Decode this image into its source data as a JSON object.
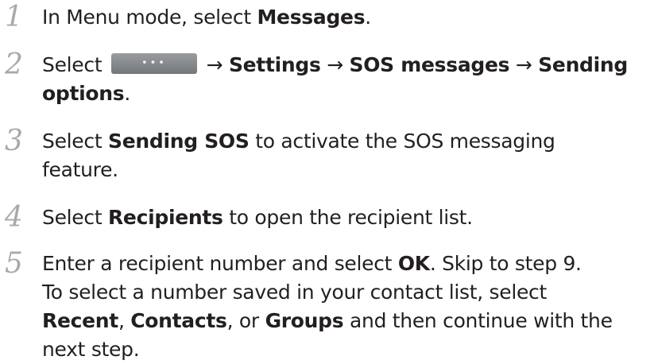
{
  "steps": [
    {
      "number": "1",
      "lines": [
        [
          {
            "t": "In Menu mode, select ",
            "b": false
          },
          {
            "t": "Messages",
            "b": true
          },
          {
            "t": ".",
            "b": false
          }
        ]
      ]
    },
    {
      "number": "2",
      "lines": [
        [
          {
            "t": "Select ",
            "b": false
          },
          {
            "icon": "more-options-button"
          },
          {
            "t": " → ",
            "b": false
          },
          {
            "t": "Settings",
            "b": true
          },
          {
            "t": " → ",
            "b": false
          },
          {
            "t": "SOS messages",
            "b": true
          },
          {
            "t": " → ",
            "b": false
          },
          {
            "t": "Sending",
            "b": true
          }
        ],
        [
          {
            "t": "options",
            "b": true
          },
          {
            "t": ".",
            "b": false
          }
        ]
      ]
    },
    {
      "number": "3",
      "lines": [
        [
          {
            "t": "Select ",
            "b": false
          },
          {
            "t": "Sending SOS",
            "b": true
          },
          {
            "t": " to activate the SOS messaging",
            "b": false
          }
        ],
        [
          {
            "t": "feature.",
            "b": false
          }
        ]
      ]
    },
    {
      "number": "4",
      "lines": [
        [
          {
            "t": "Select ",
            "b": false
          },
          {
            "t": "Recipients",
            "b": true
          },
          {
            "t": " to open the recipient list.",
            "b": false
          }
        ]
      ]
    },
    {
      "number": "5",
      "lines": [
        [
          {
            "t": "Enter a recipient number and select ",
            "b": false
          },
          {
            "t": "OK",
            "b": true
          },
          {
            "t": ". Skip to step 9.",
            "b": false
          }
        ],
        [
          {
            "t": "To select a number saved in your contact list, select",
            "b": false
          }
        ],
        [
          {
            "t": "Recent",
            "b": true
          },
          {
            "t": ", ",
            "b": false
          },
          {
            "t": "Contacts",
            "b": true
          },
          {
            "t": ", or ",
            "b": false
          },
          {
            "t": "Groups",
            "b": true
          },
          {
            "t": " and then continue with the",
            "b": false
          }
        ],
        [
          {
            "t": "next step.",
            "b": false
          }
        ]
      ]
    }
  ],
  "icon_dots": "•••"
}
